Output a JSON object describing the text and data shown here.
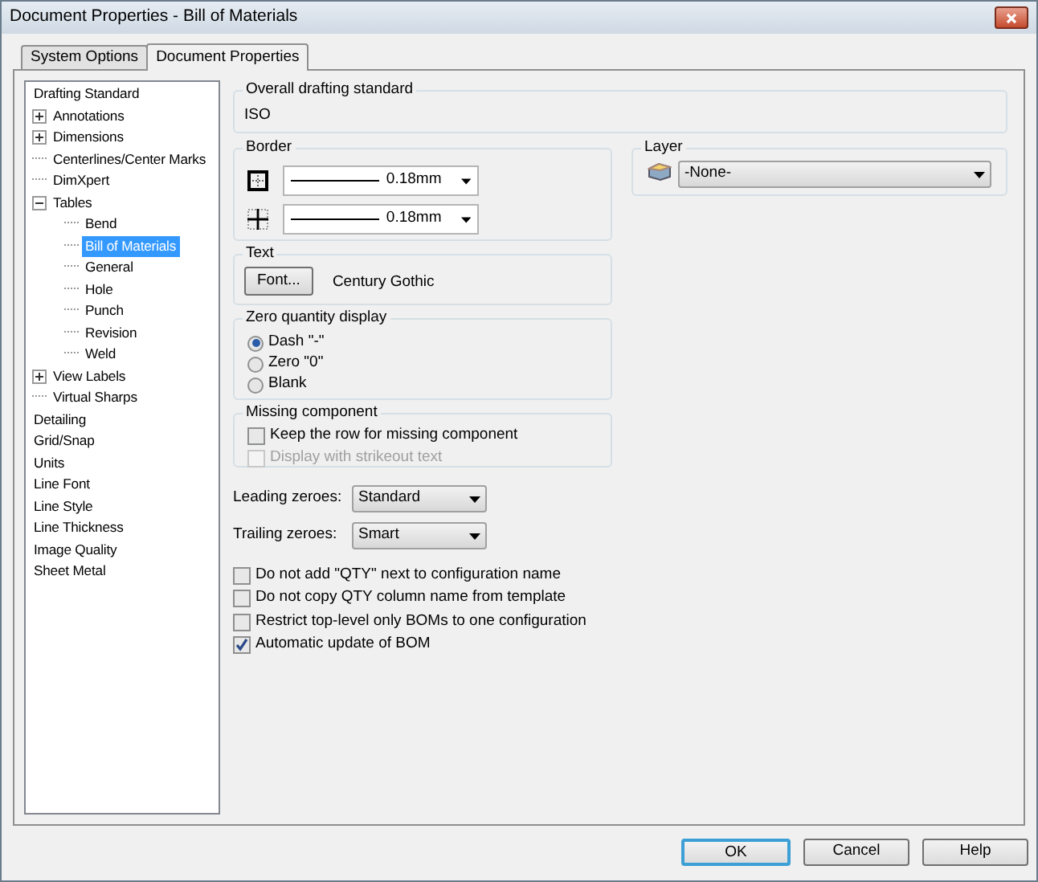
{
  "window": {
    "title": "Document Properties - Bill of Materials"
  },
  "tabs": [
    {
      "label": "System Options",
      "selected": false
    },
    {
      "label": "Document Properties",
      "selected": true
    }
  ],
  "tree": [
    {
      "label": "Drafting Standard",
      "selected": false,
      "children": [
        {
          "label": "Annotations",
          "kind": "node",
          "expanded": false,
          "selected": false
        },
        {
          "label": "Dimensions",
          "kind": "node",
          "expanded": false,
          "selected": false
        },
        {
          "label": "Centerlines/Center Marks",
          "kind": "leaf",
          "selected": false
        },
        {
          "label": "DimXpert",
          "kind": "leaf",
          "selected": false
        },
        {
          "label": "Tables",
          "kind": "node",
          "expanded": true,
          "selected": false,
          "children": [
            {
              "label": "Bend",
              "kind": "leaf",
              "selected": false
            },
            {
              "label": "Bill of Materials",
              "kind": "leaf",
              "selected": true
            },
            {
              "label": "General",
              "kind": "leaf",
              "selected": false
            },
            {
              "label": "Hole",
              "kind": "leaf",
              "selected": false
            },
            {
              "label": "Punch",
              "kind": "leaf",
              "selected": false
            },
            {
              "label": "Revision",
              "kind": "leaf",
              "selected": false
            },
            {
              "label": "Weld",
              "kind": "leaf",
              "selected": false
            }
          ]
        },
        {
          "label": "View Labels",
          "kind": "node",
          "expanded": false,
          "selected": false
        },
        {
          "label": "Virtual Sharps",
          "kind": "leaf",
          "selected": false
        }
      ]
    },
    {
      "label": "Detailing",
      "selected": false
    },
    {
      "label": "Grid/Snap",
      "selected": false
    },
    {
      "label": "Units",
      "selected": false
    },
    {
      "label": "Line Font",
      "selected": false
    },
    {
      "label": "Line Style",
      "selected": false
    },
    {
      "label": "Line Thickness",
      "selected": false
    },
    {
      "label": "Image Quality",
      "selected": false
    },
    {
      "label": "Sheet Metal",
      "selected": false
    }
  ],
  "overall_drafting_standard": {
    "title": "Overall drafting standard",
    "value": "ISO"
  },
  "border": {
    "title": "Border",
    "rows": [
      {
        "kind": "outer",
        "value": "0.18mm"
      },
      {
        "kind": "inner",
        "value": "0.18mm"
      }
    ]
  },
  "layer": {
    "title": "Layer",
    "value": "-None-"
  },
  "text": {
    "title": "Text",
    "button": "Font...",
    "font": "Century Gothic"
  },
  "zero_quantity_display": {
    "title": "Zero quantity display",
    "options": [
      {
        "label": "Dash \"-\"",
        "selected": true
      },
      {
        "label": "Zero \"0\"",
        "selected": false
      },
      {
        "label": "Blank",
        "selected": false
      }
    ]
  },
  "missing_component": {
    "title": "Missing component",
    "options": [
      {
        "label": "Keep the row for missing component",
        "checked": false,
        "disabled": false
      },
      {
        "label": "Display with strikeout text",
        "checked": false,
        "disabled": true
      }
    ]
  },
  "dropdowns": [
    {
      "label": "Leading zeroes:",
      "value": "Standard"
    },
    {
      "label": "Trailing zeroes:",
      "value": "Smart"
    }
  ],
  "checkboxes": [
    {
      "label": "Do not add \"QTY\" next to configuration name",
      "checked": false
    },
    {
      "label": "Do not copy QTY column name from template",
      "checked": false
    },
    {
      "label": "Restrict top-level only BOMs to one configuration",
      "checked": false
    },
    {
      "label": "Automatic update of BOM",
      "checked": true
    }
  ],
  "buttons": [
    {
      "label": "OK",
      "kind": "default"
    },
    {
      "label": "Cancel",
      "kind": "normal"
    },
    {
      "label": "Help",
      "kind": "normal"
    }
  ]
}
